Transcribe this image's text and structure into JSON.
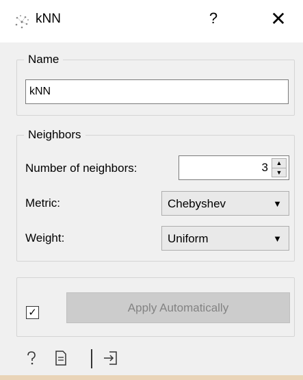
{
  "window": {
    "title": "kNN",
    "help_glyph": "?",
    "close_glyph": "✕",
    "icon": "knn-scatter-icon"
  },
  "name_section": {
    "legend": "Name",
    "value": "kNN"
  },
  "neighbors_section": {
    "legend": "Neighbors",
    "number_label": "Number of neighbors:",
    "number_value": "3",
    "metric_label": "Metric:",
    "metric_value": "Chebyshev",
    "weight_label": "Weight:",
    "weight_value": "Uniform"
  },
  "apply": {
    "auto_checked": true,
    "checkbox_glyph": "✓",
    "button_label": "Apply Automatically"
  },
  "footer": {
    "help_icon": "question-icon",
    "report_icon": "report-icon",
    "output_icon": "output-icon"
  },
  "colors": {
    "background": "#f0f0f0",
    "disabled_text": "#838383"
  }
}
